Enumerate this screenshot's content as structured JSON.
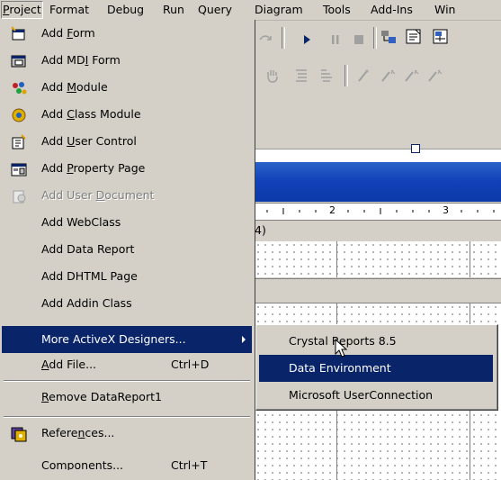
{
  "menubar": {
    "items": [
      {
        "label": "Project",
        "active": true
      },
      {
        "label": "Format"
      },
      {
        "label": "Debug"
      },
      {
        "label": "Run"
      },
      {
        "label": "Query"
      },
      {
        "label": "Diagram"
      },
      {
        "label": "Tools"
      },
      {
        "label": "Add-Ins"
      },
      {
        "label": "Win"
      }
    ]
  },
  "project_menu": {
    "items": [
      {
        "pre": "Add ",
        "ul": "F",
        "post": "orm",
        "icon": "form-icon"
      },
      {
        "pre": "Add MD",
        "ul": "I",
        "post": " Form",
        "icon": "mdi-form-icon"
      },
      {
        "pre": "Add ",
        "ul": "M",
        "post": "odule",
        "icon": "module-icon"
      },
      {
        "pre": "Add ",
        "ul": "C",
        "post": "lass Module",
        "icon": "class-module-icon"
      },
      {
        "pre": "Add ",
        "ul": "U",
        "post": "ser Control",
        "icon": "user-control-icon"
      },
      {
        "pre": "Add ",
        "ul": "P",
        "post": "roperty Page",
        "icon": "property-page-icon"
      },
      {
        "pre": "Add User ",
        "ul": "D",
        "post": "ocument",
        "icon": "user-document-icon",
        "disabled": true
      },
      {
        "pre": "Add WebClass",
        "ul": "",
        "post": ""
      },
      {
        "pre": "Add Data Report",
        "ul": "",
        "post": ""
      },
      {
        "pre": "Add DHTML Page",
        "ul": "",
        "post": ""
      },
      {
        "pre": "Add Addin Class",
        "ul": "",
        "post": ""
      },
      {
        "pre": "More ActiveX Designers...",
        "ul": "",
        "post": "",
        "highlighted": true,
        "submenu": true
      },
      {
        "pre": "",
        "ul": "A",
        "post": "dd File...",
        "accel": "Ctrl+D"
      },
      {
        "pre": "",
        "ul": "R",
        "post": "emove DataReport1"
      },
      {
        "pre": "Refere",
        "ul": "n",
        "post": "ces...",
        "icon": "references-icon"
      },
      {
        "pre": "Compo",
        "ul": "n",
        "post": "ents...",
        "accel": "Ctrl+T"
      }
    ]
  },
  "submenu": {
    "items": [
      {
        "label": "Crystal Reports 8.5"
      },
      {
        "label": "Data Environment",
        "highlighted": true
      },
      {
        "label": "Microsoft UserConnection"
      }
    ]
  },
  "designer": {
    "ruler_ticks": [
      "2",
      "3"
    ],
    "section_label": "4)"
  },
  "colors": {
    "menu_bg": "#d4d0c8",
    "highlight": "#0a246a",
    "title_blue": "#1140b8"
  }
}
